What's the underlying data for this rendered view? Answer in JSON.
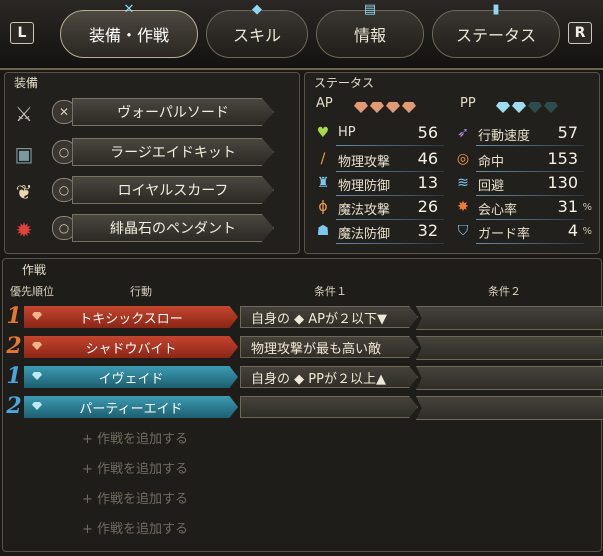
{
  "shoulders": {
    "left": "L",
    "right": "R"
  },
  "tabs": [
    {
      "label": "装備・作戦",
      "icon": "sword-icon",
      "active": true
    },
    {
      "label": "スキル",
      "icon": "diamond-icon",
      "active": false
    },
    {
      "label": "情報",
      "icon": "book-icon",
      "active": false
    },
    {
      "label": "ステータス",
      "icon": "status-icon",
      "active": false
    }
  ],
  "equipment": {
    "title": "装備",
    "items": [
      {
        "name": "ヴォーパルソード",
        "icon": "sword-icon",
        "slot_icon": "dagger-slot-icon"
      },
      {
        "name": "ラージエイドキット",
        "icon": "chest-icon",
        "slot_icon": "ring-slot-icon"
      },
      {
        "name": "ロイヤルスカーフ",
        "icon": "scarf-icon",
        "slot_icon": "ring-slot-icon"
      },
      {
        "name": "緋晶石のペンダント",
        "icon": "pendant-icon",
        "slot_icon": "ring-slot-icon"
      }
    ]
  },
  "status": {
    "title": "ステータス",
    "ap_label": "AP",
    "pp_label": "PP",
    "ap_gems_filled": 4,
    "pp_gems_filled": 2,
    "pp_gems_total": 4,
    "left": [
      {
        "label": "HP",
        "value": "56",
        "icon": "heart-icon"
      },
      {
        "label": "物理攻撃",
        "value": "46",
        "icon": "sword-icon"
      },
      {
        "label": "物理防御",
        "value": "13",
        "icon": "armor-icon"
      },
      {
        "label": "魔法攻撃",
        "value": "26",
        "icon": "wand-icon"
      },
      {
        "label": "魔法防御",
        "value": "32",
        "icon": "magic-shield-icon"
      }
    ],
    "right": [
      {
        "label": "行動速度",
        "value": "57",
        "unit": "",
        "icon": "speed-icon"
      },
      {
        "label": "命中",
        "value": "153",
        "unit": "",
        "icon": "target-icon"
      },
      {
        "label": "回避",
        "value": "130",
        "unit": "",
        "icon": "evade-icon"
      },
      {
        "label": "会心率",
        "value": "31",
        "unit": "%",
        "icon": "critical-icon"
      },
      {
        "label": "ガード率",
        "value": "4",
        "unit": "%",
        "icon": "guard-icon"
      }
    ]
  },
  "tactics": {
    "title": "作戦",
    "headers": {
      "priority": "優先順位",
      "action": "行動",
      "cond1": "条件１",
      "cond2": "条件２"
    },
    "rows": [
      {
        "priority": "1",
        "action": "トキシックスロー",
        "type": "ap",
        "cond1": "自身の ◆ APが２以下▼",
        "cond2": ""
      },
      {
        "priority": "2",
        "action": "シャドウバイト",
        "type": "ap",
        "cond1": "物理攻撃が最も高い敵",
        "cond2": ""
      },
      {
        "priority": "1",
        "action": "イヴェイド",
        "type": "pp",
        "cond1": "自身の ◆ PPが２以上▲",
        "cond2": ""
      },
      {
        "priority": "2",
        "action": "パーティーエイド",
        "type": "pp",
        "cond1": "",
        "cond2": ""
      }
    ],
    "add_label": "+ 作戦を追加する",
    "add_rows": 4
  },
  "colors": {
    "ap_bar": "#a8331f",
    "pp_bar": "#2c7f95",
    "ap_prio": "#e5772f",
    "pp_prio": "#4aa6df",
    "accent_red": "#e8584a",
    "accent_cyan": "#8fd8f0"
  }
}
